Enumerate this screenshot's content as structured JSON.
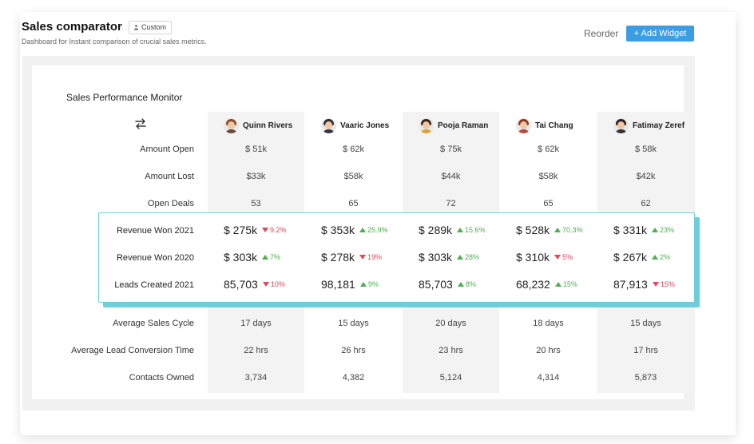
{
  "header": {
    "title": "Sales comparator",
    "badge": "Custom",
    "subtitle": "Dashboard for Instant comparison of crucial sales metrics.",
    "reorder": "Reorder",
    "add_widget": "+ Add Widget"
  },
  "widget": {
    "title": "Sales Performance Monitor",
    "swap_icon": "swap-arrows-icon"
  },
  "people": [
    {
      "name": "Quinn Rivers",
      "hair": "#8a4b2a",
      "shirt": "#6a4a3a"
    },
    {
      "name": "Vaaric Jones",
      "hair": "#2f2f2f",
      "shirt": "#333344"
    },
    {
      "name": "Pooja Raman",
      "hair": "#3b2418",
      "shirt": "#e0a030"
    },
    {
      "name": "Tai Chang",
      "hair": "#8a3a24",
      "shirt": "#b84a3a"
    },
    {
      "name": "Fatimay Zeref",
      "hair": "#2b1f1a",
      "shirt": "#333333"
    }
  ],
  "rows_top": [
    {
      "label": "Amount Open",
      "values": [
        "$ 51k",
        "$ 62k",
        "$ 75k",
        "$ 62k",
        "$ 58k"
      ]
    },
    {
      "label": "Amount Lost",
      "values": [
        "$33k",
        "$58k",
        "$44k",
        "$58k",
        "$42k"
      ]
    },
    {
      "label": "Open Deals",
      "values": [
        "53",
        "65",
        "72",
        "65",
        "62"
      ]
    }
  ],
  "rows_highlight": [
    {
      "label": "Revenue Won 2021",
      "values": [
        {
          "value": "$ 275k",
          "delta": "9.2%",
          "dir": "down"
        },
        {
          "value": "$ 353k",
          "delta": "25.9%",
          "dir": "up"
        },
        {
          "value": "$ 289k",
          "delta": "15.6%",
          "dir": "up"
        },
        {
          "value": "$ 528k",
          "delta": "70.3%",
          "dir": "up"
        },
        {
          "value": "$ 331k",
          "delta": "23%",
          "dir": "up"
        }
      ]
    },
    {
      "label": "Revenue Won 2020",
      "values": [
        {
          "value": "$ 303k",
          "delta": "7%",
          "dir": "up"
        },
        {
          "value": "$ 278k",
          "delta": "19%",
          "dir": "down"
        },
        {
          "value": "$ 303k",
          "delta": "28%",
          "dir": "up"
        },
        {
          "value": "$ 310k",
          "delta": "5%",
          "dir": "down"
        },
        {
          "value": "$ 267k",
          "delta": "2%",
          "dir": "up"
        }
      ]
    },
    {
      "label": "Leads Created 2021",
      "values": [
        {
          "value": "85,703",
          "delta": "10%",
          "dir": "down"
        },
        {
          "value": "98,181",
          "delta": "9%",
          "dir": "up"
        },
        {
          "value": "85,703",
          "delta": "8%",
          "dir": "up"
        },
        {
          "value": "68,232",
          "delta": "15%",
          "dir": "up"
        },
        {
          "value": "87,913",
          "delta": "15%",
          "dir": "down"
        }
      ]
    }
  ],
  "rows_bottom": [
    {
      "label": "Average Sales Cycle",
      "values": [
        "17 days",
        "15 days",
        "20 days",
        "18 days",
        "15 days"
      ]
    },
    {
      "label": "Average Lead Conversion Time",
      "values": [
        "22 hrs",
        "26 hrs",
        "23 hrs",
        "20 hrs",
        "17 hrs"
      ]
    },
    {
      "label": "Contacts Owned",
      "values": [
        "3,734",
        "4,382",
        "5,124",
        "4,314",
        "5,873"
      ]
    }
  ],
  "colors": {
    "accent": "#3d9de2",
    "highlight_border": "#6dcfd9",
    "up": "#4caf50",
    "down": "#e2475b"
  }
}
